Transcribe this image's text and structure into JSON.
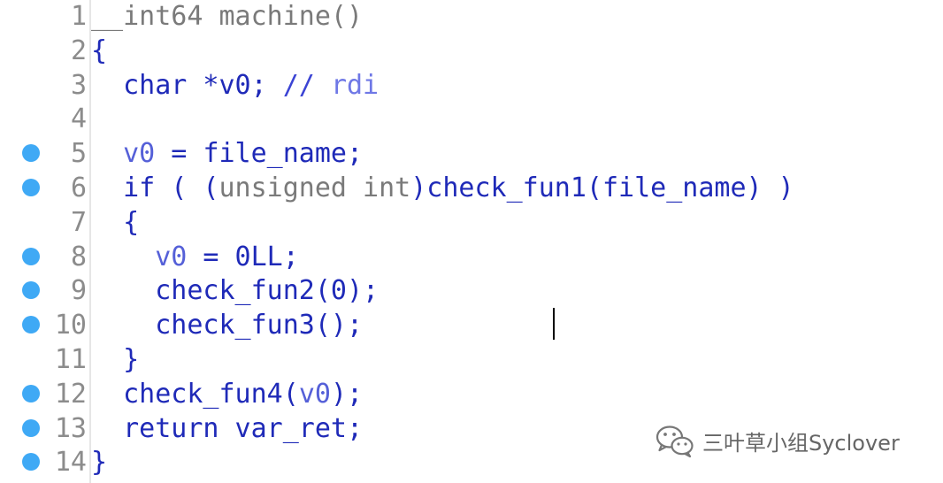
{
  "editor": {
    "lines": [
      {
        "num": "1",
        "breakpoint": false,
        "indent": "",
        "tokens": [
          {
            "t": "__int64 machine()",
            "c": "t-gray"
          }
        ]
      },
      {
        "num": "2",
        "breakpoint": false,
        "indent": "",
        "tokens": [
          {
            "t": "{",
            "c": "t-blue"
          }
        ]
      },
      {
        "num": "3",
        "breakpoint": false,
        "indent": "  ",
        "tokens": [
          {
            "t": "char *v0; ",
            "c": "t-blue"
          },
          {
            "t": "// ",
            "c": "t-comment"
          },
          {
            "t": "rdi",
            "c": "t-rdi"
          }
        ]
      },
      {
        "num": "4",
        "breakpoint": false,
        "indent": "",
        "tokens": []
      },
      {
        "num": "5",
        "breakpoint": true,
        "indent": "  ",
        "tokens": [
          {
            "t": "v0",
            "c": "t-lightblue"
          },
          {
            "t": " = ",
            "c": "t-blue"
          },
          {
            "t": "file_name;",
            "c": "t-blue"
          }
        ]
      },
      {
        "num": "6",
        "breakpoint": true,
        "indent": "  ",
        "tokens": [
          {
            "t": "if ( (",
            "c": "t-blue"
          },
          {
            "t": "unsigned int",
            "c": "t-gray"
          },
          {
            "t": ")check_fun1(file_name) )",
            "c": "t-blue"
          }
        ]
      },
      {
        "num": "7",
        "breakpoint": false,
        "indent": "  ",
        "tokens": [
          {
            "t": "{",
            "c": "t-blue"
          }
        ]
      },
      {
        "num": "8",
        "breakpoint": true,
        "indent": "    ",
        "tokens": [
          {
            "t": "v0",
            "c": "t-lightblue"
          },
          {
            "t": " = 0LL;",
            "c": "t-blue"
          }
        ]
      },
      {
        "num": "9",
        "breakpoint": true,
        "indent": "    ",
        "tokens": [
          {
            "t": "check_fun2(0);",
            "c": "t-blue"
          }
        ]
      },
      {
        "num": "10",
        "breakpoint": true,
        "indent": "    ",
        "tokens": [
          {
            "t": "check_fun3();",
            "c": "t-blue"
          }
        ]
      },
      {
        "num": "11",
        "breakpoint": false,
        "indent": "  ",
        "tokens": [
          {
            "t": "}",
            "c": "t-blue"
          }
        ]
      },
      {
        "num": "12",
        "breakpoint": true,
        "indent": "  ",
        "tokens": [
          {
            "t": "check_fun4(",
            "c": "t-blue"
          },
          {
            "t": "v0",
            "c": "t-lightblue"
          },
          {
            "t": ");",
            "c": "t-blue"
          }
        ]
      },
      {
        "num": "13",
        "breakpoint": true,
        "indent": "  ",
        "tokens": [
          {
            "t": "return var_ret;",
            "c": "t-blue"
          }
        ]
      },
      {
        "num": "14",
        "breakpoint": true,
        "indent": "",
        "tokens": [
          {
            "t": "}",
            "c": "t-blue"
          }
        ]
      }
    ]
  },
  "watermark": {
    "icon": "wechat-icon",
    "text": "三叶草小组Syclover"
  },
  "colors": {
    "breakpoint": "#3fa9f5",
    "code": "#1f2ab8",
    "keyword_type": "#7a7a7a"
  }
}
